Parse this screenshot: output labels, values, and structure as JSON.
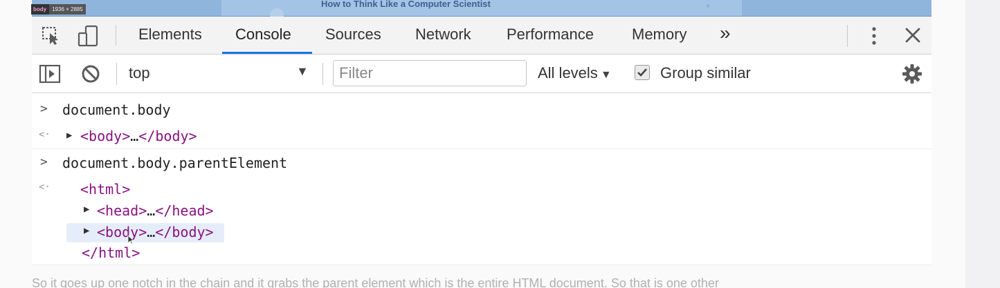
{
  "page": {
    "title": "How to Think Like a Computer Scientist",
    "tooltip_tag": "body",
    "tooltip_size": "1936 × 2885"
  },
  "tabs": [
    "Elements",
    "Console",
    "Sources",
    "Network",
    "Performance",
    "Memory"
  ],
  "tabs_more": "»",
  "active_tab": "Console",
  "toolbar": {
    "context": "top",
    "filter_placeholder": "Filter",
    "levels": "All levels",
    "group_similar": "Group similar",
    "group_similar_checked": true
  },
  "console": {
    "cmd1": "document.body",
    "res1_open": "<body>",
    "res1_ellipsis": "…",
    "res1_close": "</body>",
    "cmd2": "document.body.parentElement",
    "html_open": "<html>",
    "head_open": "<head>",
    "head_ellipsis": "…",
    "head_close": "</head>",
    "body_open": "<body>",
    "body_ellipsis": "…",
    "body_close": "</body>",
    "html_close": "</html>",
    "prompt_symbol": ">",
    "result_symbol": "<·"
  },
  "caption": "So it goes up one notch in the chain and it grabs the parent element which is the entire HTML document. So that is one other",
  "colors": {
    "accent": "#1a73e8",
    "tag": "#881280",
    "highlight": "#8fb5dd"
  }
}
